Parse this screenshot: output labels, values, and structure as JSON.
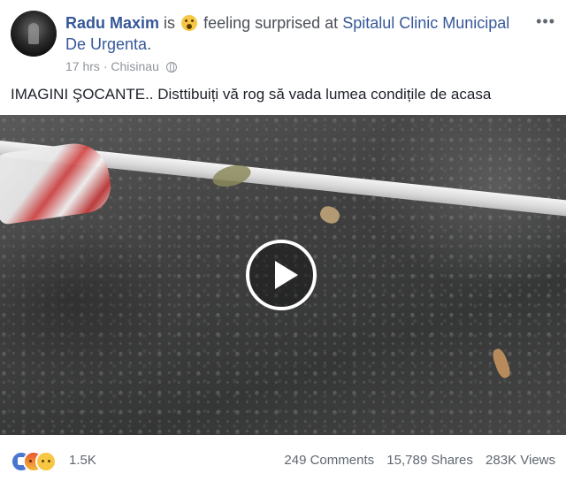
{
  "post": {
    "author": "Radu Maxim",
    "is_word": "is",
    "feeling_text": "feeling surprised at",
    "place": "Spitalul Clinic Municipal De Urgenta",
    "period": ".",
    "time": "17 hrs",
    "separator": "·",
    "location": "Chisinau",
    "more_icon": "more-dots-icon",
    "text": "IMAGINI ŞOCANTE.. Disttibuiți vă rog să vada lumea condițile de acasa"
  },
  "video": {
    "play_icon": "play-icon"
  },
  "footer": {
    "reaction_count": "1.5K",
    "comments": "249 Comments",
    "shares": "15,789 Shares",
    "views": "283K Views"
  },
  "colors": {
    "link": "#365899",
    "meta": "#90949c",
    "like_blue": "#4a76d1"
  }
}
